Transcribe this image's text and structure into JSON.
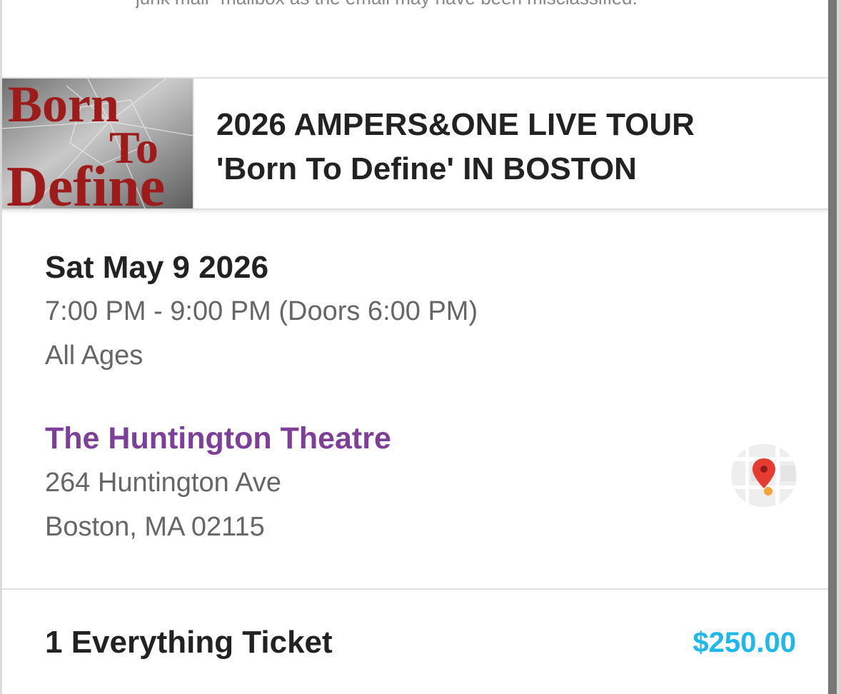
{
  "notice": {
    "text": "junk mail\" mailbox as the email may have been misclassified."
  },
  "event": {
    "image_text": "Born To Define",
    "title_line1": "2026 AMPERS&ONE LIVE TOUR",
    "title_line2": "'Born To Define' IN BOSTON"
  },
  "schedule": {
    "date": "Sat May 9 2026",
    "time": "7:00 PM - 9:00 PM (Doors 6:00 PM)",
    "age": "All Ages"
  },
  "venue": {
    "name": "The Huntington Theatre",
    "street": "264 Huntington Ave",
    "city": "Boston, MA 02115"
  },
  "ticket": {
    "label": "1 Everything Ticket",
    "price": "$250.00"
  },
  "colors": {
    "venue_link": "#7d3f98",
    "price": "#1fb8ea",
    "image_lettering": "#9e1b1b"
  },
  "icons": {
    "map": "map-pin-icon"
  }
}
